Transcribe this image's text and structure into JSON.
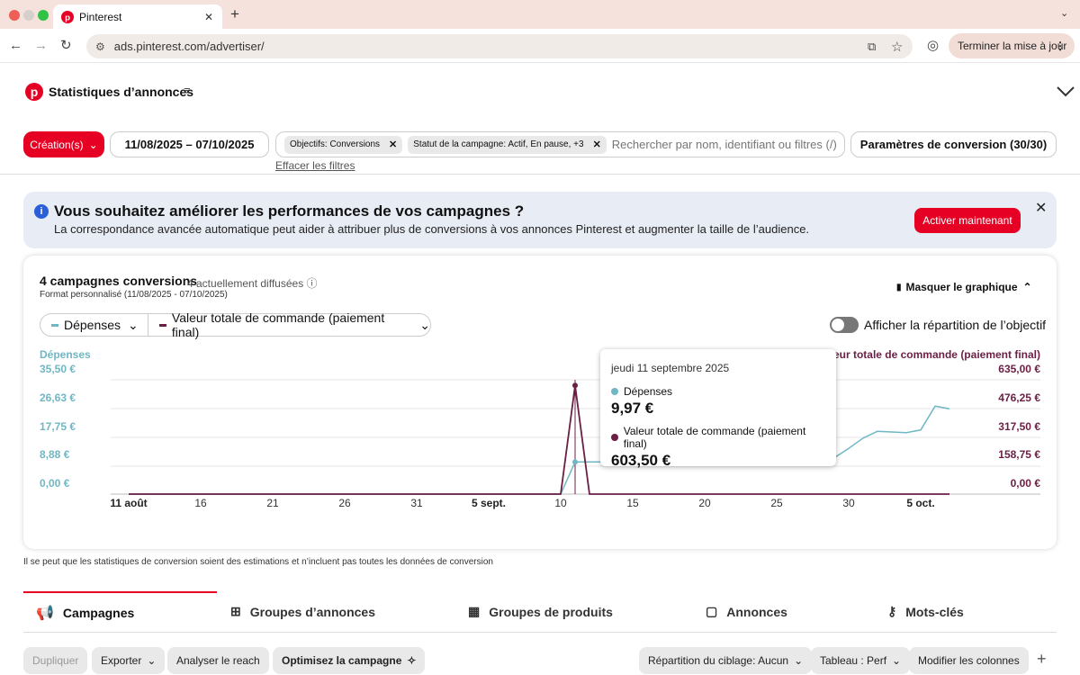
{
  "browser": {
    "tab_title": "Pinterest",
    "url": "ads.pinterest.com/advertiser/",
    "update_label": "Terminer la mise à jour"
  },
  "header": {
    "title": "Statistiques d’annonces"
  },
  "filters": {
    "creation_label": "Création(s)",
    "date_range": "11/08/2025 – 07/10/2025",
    "chips": [
      "Objectifs: Conversions",
      "Statut de la campagne: Actif, En pause, +3"
    ],
    "search_placeholder": "Rechercher par nom, identifiant ou filtres (/)",
    "conversion_settings": "Paramètres de conversion (30/30)",
    "clear_filters": "Effacer les filtres"
  },
  "banner": {
    "title": "Vous souhaitez améliorer les performances de vos campagnes ?",
    "text": "La correspondance avancée automatique peut aider à attribuer plus de conversions à vos annonces Pinterest et augmenter la taille de l’audience.",
    "cta": "Activer maintenant"
  },
  "summary": {
    "title": "4 campagnes conversions",
    "subtitle": "4 actuellement diffusées",
    "format": "Format personnalisé (11/08/2025 - 07/10/2025)",
    "hide_chart": "Masquer le graphique",
    "metric1": "Dépenses",
    "metric2": "Valeur totale de commande (paiement final)",
    "toggle_label": "Afficher la répartition de l’objectif"
  },
  "chart_data": {
    "type": "line",
    "series": [
      {
        "name": "Dépenses",
        "axis": "left",
        "color": "#6fb7c4",
        "values": [
          0,
          0,
          0,
          0,
          0,
          0,
          0,
          0,
          0,
          0,
          0,
          0,
          0,
          0,
          0,
          0,
          0,
          0,
          0,
          0,
          0,
          0,
          0,
          0,
          0,
          0,
          0,
          0,
          0,
          0,
          0,
          9.97,
          9.97,
          9.97,
          9.97,
          9.97,
          9.97,
          9.97,
          9.97,
          9.97,
          9.97,
          9.97,
          9.97,
          9.97,
          9.97,
          9.97,
          9.97,
          9.97,
          9.97,
          11.3,
          14.2,
          17.4,
          19.5,
          19.3,
          19.1,
          19.9,
          27.3,
          26.5
        ]
      },
      {
        "name": "Valeur totale de commande (paiement final)",
        "axis": "right",
        "color": "#6b1f45",
        "values": [
          0,
          0,
          0,
          0,
          0,
          0,
          0,
          0,
          0,
          0,
          0,
          0,
          0,
          0,
          0,
          0,
          0,
          0,
          0,
          0,
          0,
          0,
          0,
          0,
          0,
          0,
          0,
          0,
          0,
          0,
          0,
          603.5,
          0,
          0,
          0,
          0,
          0,
          0,
          0,
          0,
          0,
          0,
          0,
          0,
          0,
          0,
          0,
          0,
          0,
          0,
          0,
          0,
          0,
          0,
          0,
          0,
          0,
          0
        ]
      }
    ],
    "x_ticks": [
      "11 août",
      "16",
      "21",
      "26",
      "31",
      "5 sept.",
      "10",
      "15",
      "20",
      "25",
      "30",
      "5 oct."
    ],
    "y_left": {
      "label": "Dépenses",
      "ticks": [
        "35,50 €",
        "26,63 €",
        "17,75 €",
        "8,88 €",
        "0,00 €"
      ],
      "range": [
        0,
        35.5
      ]
    },
    "y_right": {
      "label": "Valeur totale de commande (paiement final)",
      "ticks": [
        "635,00 €",
        "476,25 €",
        "317,50 €",
        "158,75 €",
        "0,00 €"
      ],
      "range": [
        0,
        635
      ]
    }
  },
  "tooltip": {
    "date": "jeudi 11 septembre 2025",
    "s1_name": "Dépenses",
    "s1_value": "9,97 €",
    "s2_name": "Valeur totale de commande (paiement final)",
    "s2_value": "603,50 €"
  },
  "disclaimer": "Il se peut que les statistiques de conversion soient des estimations et n’incluent pas toutes les données de conversion",
  "tabs": [
    "Campagnes",
    "Groupes d’annonces",
    "Groupes de produits",
    "Annonces",
    "Mots-clés"
  ],
  "actions": {
    "duplicate": "Dupliquer",
    "export": "Exporter",
    "reach": "Analyser le reach",
    "optimize": "Optimisez la campagne",
    "targeting": "Répartition du ciblage: Aucun",
    "table": "Tableau : Perf",
    "columns": "Modifier les colonnes"
  },
  "colors": {
    "brand": "#e60023",
    "spend": "#6fb7c4",
    "order_value": "#6b1f45",
    "banner_bg": "#e8ecf5"
  }
}
